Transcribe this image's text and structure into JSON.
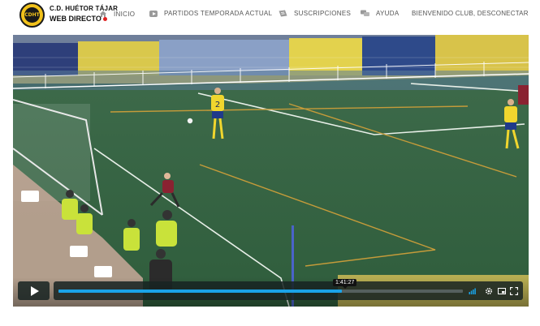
{
  "header": {
    "club_name": "C.D. HUÉTOR TÁJAR",
    "brand_live": "WEB DIRECTO",
    "logo_text": "CDHT",
    "nav": [
      {
        "label": "INICIO",
        "icon": "home-icon"
      },
      {
        "label": "PARTIDOS TEMPORADA ACTUAL",
        "icon": "youtube-icon"
      },
      {
        "label": "SUSCRIPCIONES",
        "icon": "ticket-icon"
      },
      {
        "label": "AYUDA",
        "icon": "chat-icon"
      }
    ],
    "welcome": "BIENVENIDO CLUB, DESCONECTAR"
  },
  "player": {
    "current_time_tooltip": "1:41:27",
    "progress": 0.7,
    "accent_color": "#1aa3e8",
    "icons": [
      "play-icon",
      "volume-icon",
      "settings-gear-icon",
      "picture-in-picture-icon",
      "fullscreen-icon"
    ]
  },
  "scene": {
    "player_numbers": [
      "2"
    ]
  }
}
